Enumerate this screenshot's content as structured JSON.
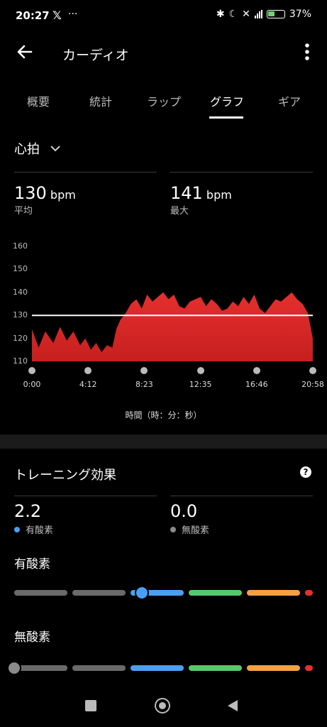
{
  "status": {
    "time": "20:27",
    "battery": "37%",
    "x_label": "𝕏",
    "more": "···"
  },
  "header": {
    "title": "カーディオ"
  },
  "tabs": [
    {
      "label": "概要"
    },
    {
      "label": "統計"
    },
    {
      "label": "ラップ"
    },
    {
      "label": "グラフ"
    },
    {
      "label": "ギア"
    }
  ],
  "selector": {
    "label": "心拍"
  },
  "metrics": {
    "avg": {
      "value": "130",
      "unit": "bpm",
      "label": "平均"
    },
    "max": {
      "value": "141",
      "unit": "bpm",
      "label": "最大"
    }
  },
  "chart_data": {
    "type": "area",
    "x_labels": [
      "0:00",
      "4:12",
      "8:23",
      "12:35",
      "16:46",
      "20:58"
    ],
    "y_ticks": [
      "160",
      "150",
      "140",
      "130",
      "120",
      "110"
    ],
    "ylim": [
      110,
      160
    ],
    "xlabel": "時間（時：分：秒）",
    "reference_line": 130,
    "fill_color": "#e5302f",
    "x_minutes": [
      0,
      0.5,
      1.0,
      1.6,
      2.1,
      2.6,
      3.1,
      3.6,
      4.0,
      4.4,
      4.8,
      5.2,
      5.6,
      6.0,
      6.3,
      6.6,
      7.0,
      7.4,
      7.8,
      8.2,
      8.6,
      9.0,
      9.4,
      9.8,
      10.2,
      10.6,
      11.0,
      11.4,
      11.8,
      12.2,
      12.6,
      13.0,
      13.4,
      13.8,
      14.2,
      14.6,
      15.0,
      15.4,
      15.8,
      16.2,
      16.6,
      17.0,
      17.4,
      17.8,
      18.2,
      18.6,
      19.0,
      19.4,
      19.8,
      20.2,
      20.6,
      20.97
    ],
    "hr_bpm": [
      124,
      116,
      123,
      118,
      125,
      119,
      123,
      117,
      120,
      115,
      118,
      114,
      117,
      116,
      124,
      128,
      131,
      135,
      137,
      133,
      139,
      136,
      138,
      140,
      137,
      139,
      134,
      133,
      136,
      137,
      138,
      134,
      137,
      135,
      132,
      133,
      136,
      134,
      138,
      135,
      139,
      133,
      131,
      134,
      137,
      136,
      138,
      140,
      137,
      135,
      131,
      120
    ]
  },
  "training": {
    "title": "トレーニング効果",
    "help": "?",
    "aerobic": {
      "value": "2.2",
      "label": "有酸素",
      "color": "#4a9ff5"
    },
    "anaerobic": {
      "value": "0.0",
      "label": "無酸素",
      "color": "#8a8a8a"
    },
    "aerobic_heading": "有酸素",
    "anaerobic_heading": "無酸素",
    "scale_colors": [
      "#6a6a6a",
      "#6a6a6a",
      "#4a9ff5",
      "#58c96b",
      "#f5a142",
      "#e5302f"
    ],
    "aerobic_level": 2.2,
    "anaerobic_level": 0.0
  }
}
